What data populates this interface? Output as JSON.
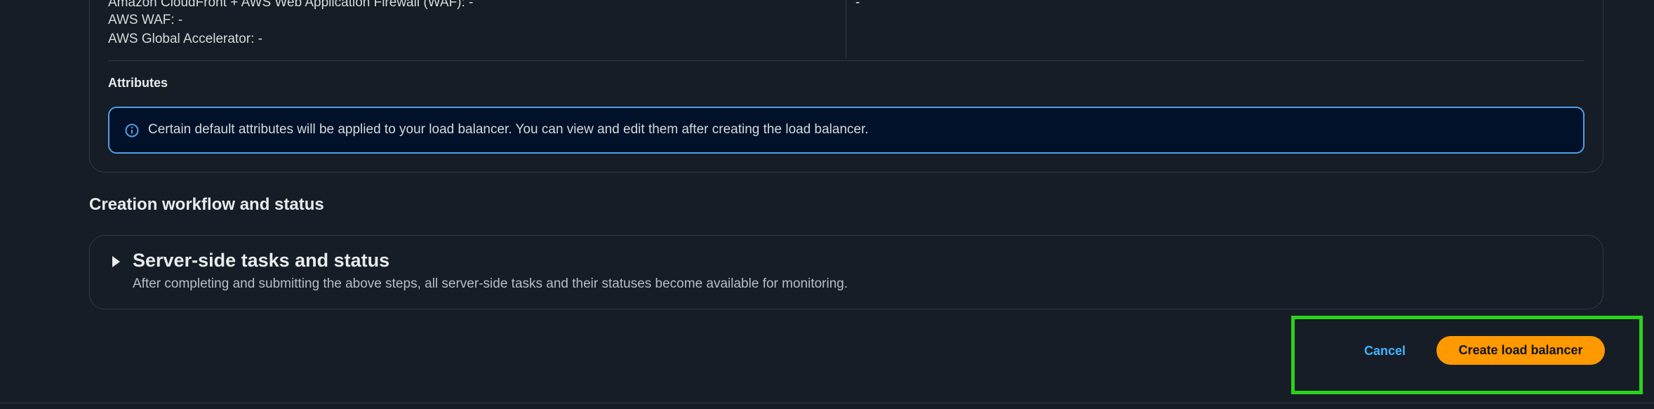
{
  "summary": {
    "rows": [
      {
        "label": "Amazon CloudFront + AWS Web Application Firewall (WAF): -",
        "right_value": "-"
      },
      {
        "label": "AWS WAF: -"
      },
      {
        "label": "AWS Global Accelerator: -"
      }
    ]
  },
  "attributes": {
    "heading": "Attributes",
    "info_text": "Certain default attributes will be applied to your load balancer. You can view and edit them after creating the load balancer.",
    "info_icon": "info-icon"
  },
  "workflow": {
    "heading": "Creation workflow and status",
    "expandable_title": "Server-side tasks and status",
    "expandable_description": "After completing and submitting the above steps, all server-side tasks and their statuses become available for monitoring.",
    "caret_icon": "caret-right-icon"
  },
  "actions": {
    "cancel_label": "Cancel",
    "create_label": "Create load balancer"
  },
  "colors": {
    "background": "#161d26",
    "accent_orange": "#ff9900",
    "link_blue": "#42b4ff",
    "info_border": "#539fe5",
    "highlight_green": "#2bd21c"
  }
}
